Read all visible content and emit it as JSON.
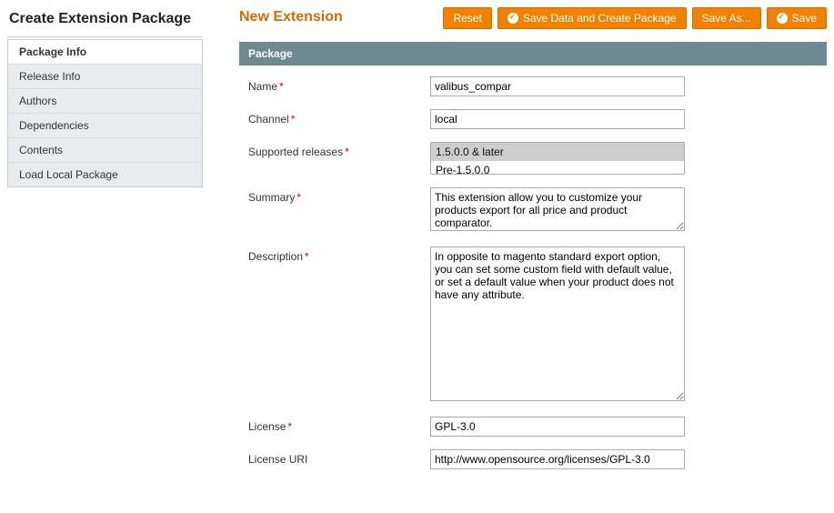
{
  "sidebar": {
    "title": "Create Extension Package",
    "items": [
      {
        "label": "Package Info"
      },
      {
        "label": "Release Info"
      },
      {
        "label": "Authors"
      },
      {
        "label": "Dependencies"
      },
      {
        "label": "Contents"
      },
      {
        "label": "Load Local Package"
      }
    ],
    "active_index": 0
  },
  "page_title": "New Extension",
  "buttons": {
    "reset": "Reset",
    "save_create": "Save Data and Create Package",
    "save_as": "Save As...",
    "save": "Save"
  },
  "section": {
    "title": "Package"
  },
  "form": {
    "name": {
      "label": "Name",
      "value": "valibus_compar"
    },
    "channel": {
      "label": "Channel",
      "value": "local"
    },
    "supported_releases": {
      "label": "Supported releases",
      "options": [
        "1.5.0.0 & later",
        "Pre-1.5.0.0"
      ],
      "selected": "1.5.0.0 & later"
    },
    "summary": {
      "label": "Summary",
      "value": "This extension allow you to customize your products export for all price and product comparator."
    },
    "description": {
      "label": "Description",
      "value": "In opposite to magento standard export option, you can set some custom field with default value, or set a default value when your product does not have any attribute."
    },
    "license": {
      "label": "License",
      "value": "GPL-3.0"
    },
    "license_uri": {
      "label": "License URI",
      "value": "http://www.opensource.org/licenses/GPL-3.0"
    }
  }
}
